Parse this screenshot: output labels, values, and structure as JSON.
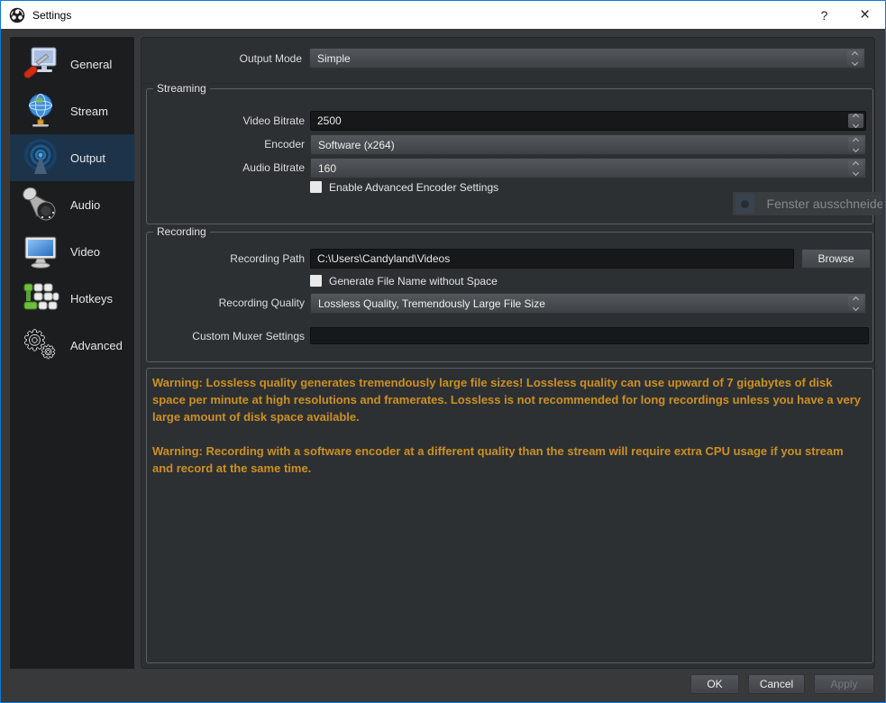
{
  "titlebar": {
    "title": "Settings",
    "help_label": "?",
    "close_label": "×"
  },
  "sidebar": {
    "selected": "Output",
    "items": [
      {
        "label": "General"
      },
      {
        "label": "Stream"
      },
      {
        "label": "Output"
      },
      {
        "label": "Audio"
      },
      {
        "label": "Video"
      },
      {
        "label": "Hotkeys"
      },
      {
        "label": "Advanced"
      }
    ]
  },
  "output_mode": {
    "label": "Output Mode",
    "value": "Simple"
  },
  "streaming": {
    "title": "Streaming",
    "video_bitrate_label": "Video Bitrate",
    "video_bitrate_value": "2500",
    "encoder_label": "Encoder",
    "encoder_value": "Software (x264)",
    "audio_bitrate_label": "Audio Bitrate",
    "audio_bitrate_value": "160",
    "advanced_encoder_label": "Enable Advanced Encoder Settings",
    "advanced_encoder_checked": false
  },
  "recording": {
    "title": "Recording",
    "path_label": "Recording Path",
    "path_value": "C:\\Users\\Candyland\\Videos",
    "browse_label": "Browse",
    "no_space_label": "Generate File Name without Space",
    "no_space_checked": false,
    "quality_label": "Recording Quality",
    "quality_value": "Lossless Quality, Tremendously Large File Size",
    "muxer_label": "Custom Muxer Settings",
    "muxer_value": ""
  },
  "warnings": {
    "warning1": "Warning: Lossless quality generates tremendously large file sizes!  Lossless quality can use upward of 7 gigabytes of disk space per minute at high resolutions and framerates.  Lossless is not recommended for long recordings unless you have a very large amount of disk space available.",
    "warning2": "Warning: Recording with a software encoder at a different quality than the stream will require extra CPU usage if you stream and record at the same time."
  },
  "overlay": {
    "label": "Fenster ausschneiden"
  },
  "footer": {
    "ok_label": "OK",
    "cancel_label": "Cancel",
    "apply_label": "Apply"
  },
  "colors": {
    "window_border": "#1079d8",
    "sidebar_bg": "#1b1d1f",
    "content_bg": "#2d3033",
    "selected_item_bg": "#1d3349",
    "warning_text": "#cc9022"
  }
}
